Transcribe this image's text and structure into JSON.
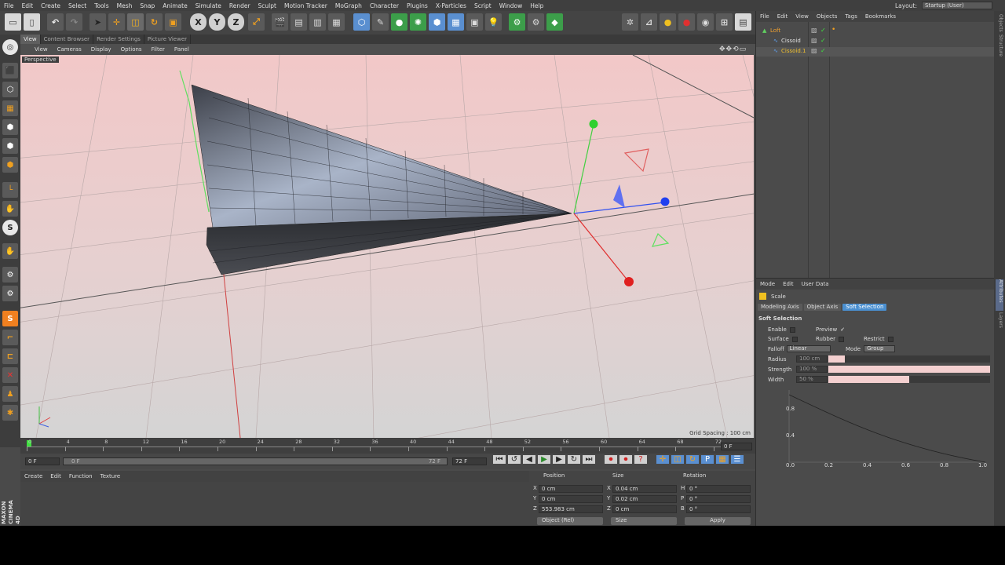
{
  "menus": [
    "File",
    "Edit",
    "Create",
    "Select",
    "Tools",
    "Mesh",
    "Snap",
    "Animate",
    "Simulate",
    "Render",
    "Sculpt",
    "Motion Tracker",
    "MoGraph",
    "Character",
    "Plugins",
    "X-Particles",
    "Script",
    "Window",
    "Help"
  ],
  "layout": {
    "label": "Layout:",
    "value": "Startup (User)"
  },
  "viewport_tabs": [
    "View",
    "Content Browser",
    "Render Settings",
    "Picture Viewer"
  ],
  "viewport_menu": [
    "View",
    "Cameras",
    "Display",
    "Options",
    "Filter",
    "Panel"
  ],
  "viewport": {
    "camera": "Perspective",
    "grid_spacing": "Grid Spacing : 100 cm"
  },
  "axis_buttons": [
    "X",
    "Y",
    "Z"
  ],
  "timeline": {
    "ticks": [
      "0",
      "4",
      "8",
      "12",
      "16",
      "20",
      "24",
      "28",
      "32",
      "36",
      "40",
      "44",
      "48",
      "52",
      "56",
      "60",
      "64",
      "68",
      "72"
    ],
    "current_frame": "0 F"
  },
  "transport": {
    "start": "0 F",
    "range_start": "0 F",
    "range_end": "72 F",
    "end": "72 F"
  },
  "material_menu": [
    "Create",
    "Edit",
    "Function",
    "Texture"
  ],
  "coords": {
    "headers": {
      "position": "Position",
      "size": "Size",
      "rotation": "Rotation"
    },
    "rows": [
      {
        "axis": "X",
        "pos": "0 cm",
        "saxis": "X",
        "size": "0.04 cm",
        "raxis": "H",
        "rot": "0 °"
      },
      {
        "axis": "Y",
        "pos": "0 cm",
        "saxis": "Y",
        "size": "0.02 cm",
        "raxis": "P",
        "rot": "0 °"
      },
      {
        "axis": "Z",
        "pos": "553.983 cm",
        "saxis": "Z",
        "size": "0 cm",
        "raxis": "B",
        "rot": "0 °"
      }
    ],
    "mode": "Object (Rel)",
    "size_mode": "Size",
    "apply": "Apply"
  },
  "object_menu": [
    "File",
    "Edit",
    "View",
    "Objects",
    "Tags",
    "Bookmarks"
  ],
  "objects": [
    {
      "name": "Loft",
      "color": "#f0a030"
    },
    {
      "name": "Cissoid",
      "color": "#e0e0e0"
    },
    {
      "name": "Cissoid.1",
      "color": "#f0c030"
    }
  ],
  "attr_menu": [
    "Mode",
    "Edit",
    "User Data"
  ],
  "attr": {
    "tool": "Scale",
    "tabs": [
      "Modeling Axis",
      "Object Axis",
      "Soft Selection"
    ],
    "section": "Soft Selection",
    "enable": "Enable",
    "preview": "Preview",
    "surface": "Surface",
    "rubber": "Rubber",
    "restrict": "Restrict",
    "falloff_label": "Falloff",
    "falloff": "Linear",
    "mode_label": "Mode",
    "mode": "Group",
    "radius_label": "Radius",
    "radius": "100 cm",
    "strength_label": "Strength",
    "strength": "100 %",
    "width_label": "Width",
    "width": "50 %",
    "strength_fill": 1.0,
    "width_fill": 0.5,
    "radius_fill": 0.1
  },
  "graph": {
    "x_ticks": [
      "0.0",
      "0.2",
      "0.4",
      "0.6",
      "0.8",
      "1.0"
    ],
    "y_ticks": [
      "0.8",
      "0.4"
    ]
  },
  "right_strip": [
    "Structure",
    "Objects",
    "Attributes",
    "Layers"
  ],
  "brand": "MAXON CINEMA 4D",
  "colors": {
    "accent": "#4a8fd0",
    "x_axis": "#e02020",
    "y_axis": "#20c020",
    "z_axis": "#2040e0",
    "selected": "#5577aa"
  }
}
